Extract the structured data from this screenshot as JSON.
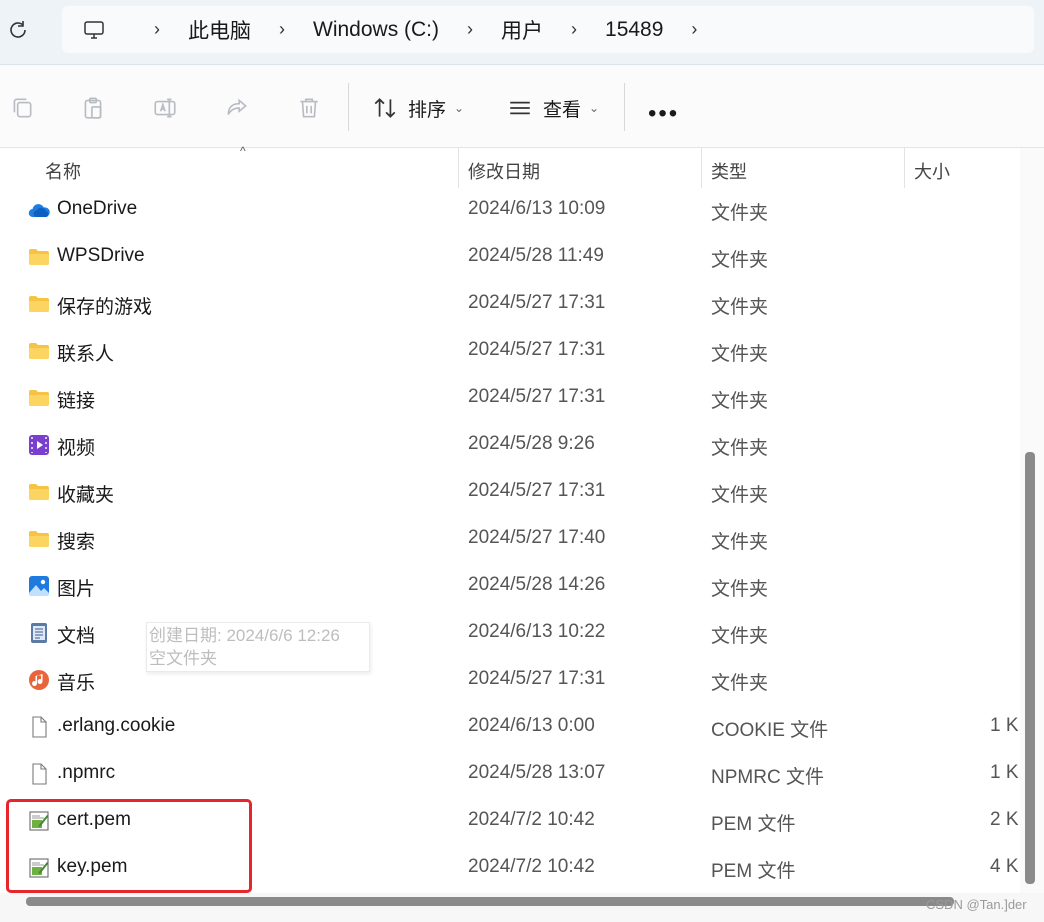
{
  "address_bar": {
    "refresh_icon": "refresh-icon",
    "pc_icon": "computer-icon",
    "breadcrumbs": [
      "此电脑",
      "Windows (C:)",
      "用户",
      "15489"
    ]
  },
  "toolbar": {
    "sort_label": "排序",
    "view_label": "查看",
    "more_label": "•••",
    "icons": [
      "copy-icon",
      "paste-icon",
      "rename-icon",
      "share-icon",
      "delete-icon"
    ]
  },
  "columns": {
    "name": "名称",
    "date": "修改日期",
    "type": "类型",
    "size": "大小"
  },
  "files": [
    {
      "name": "OneDrive",
      "date": "2024/6/13 10:09",
      "type": "文件夹",
      "size": "",
      "icon": "onedrive"
    },
    {
      "name": "WPSDrive",
      "date": "2024/5/28 11:49",
      "type": "文件夹",
      "size": "",
      "icon": "folder"
    },
    {
      "name": "保存的游戏",
      "date": "2024/5/27 17:31",
      "type": "文件夹",
      "size": "",
      "icon": "folder"
    },
    {
      "name": "联系人",
      "date": "2024/5/27 17:31",
      "type": "文件夹",
      "size": "",
      "icon": "folder"
    },
    {
      "name": "链接",
      "date": "2024/5/27 17:31",
      "type": "文件夹",
      "size": "",
      "icon": "folder"
    },
    {
      "name": "视频",
      "date": "2024/5/28 9:26",
      "type": "文件夹",
      "size": "",
      "icon": "video"
    },
    {
      "name": "收藏夹",
      "date": "2024/5/27 17:31",
      "type": "文件夹",
      "size": "",
      "icon": "folder"
    },
    {
      "name": "搜索",
      "date": "2024/5/27 17:40",
      "type": "文件夹",
      "size": "",
      "icon": "folder"
    },
    {
      "name": "图片",
      "date": "2024/5/28 14:26",
      "type": "文件夹",
      "size": "",
      "icon": "pictures"
    },
    {
      "name": "文档",
      "date": "2024/6/13 10:22",
      "type": "文件夹",
      "size": "",
      "icon": "documents"
    },
    {
      "name": "音乐",
      "date": "2024/5/27 17:31",
      "type": "文件夹",
      "size": "",
      "icon": "music"
    },
    {
      "name": ".erlang.cookie",
      "date": "2024/6/13 0:00",
      "type": "COOKIE 文件",
      "size": "1 K",
      "icon": "file"
    },
    {
      "name": ".npmrc",
      "date": "2024/5/28 13:07",
      "type": "NPMRC 文件",
      "size": "1 K",
      "icon": "file"
    },
    {
      "name": "cert.pem",
      "date": "2024/7/2 10:42",
      "type": "PEM 文件",
      "size": "2 K",
      "icon": "pem"
    },
    {
      "name": "key.pem",
      "date": "2024/7/2 10:42",
      "type": "PEM 文件",
      "size": "4 K",
      "icon": "pem"
    }
  ],
  "tooltip": {
    "line1": "创建日期: 2024/6/6 12:26",
    "line2": "空文件夹"
  },
  "watermark": "CSDN @Tan.]der",
  "colors": {
    "highlight": "#e8252b",
    "folder": "#f6c344",
    "accent": "#0f6cbd"
  }
}
